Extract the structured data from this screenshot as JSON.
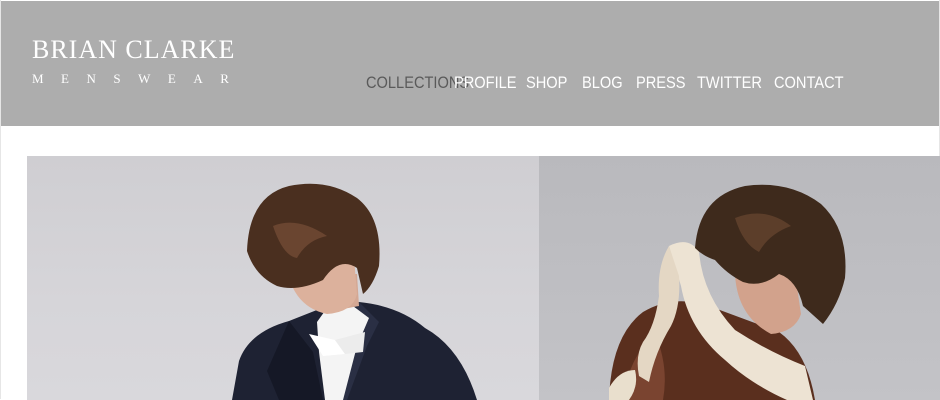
{
  "brand": {
    "title": "BRIAN CLARKE",
    "subtitle": "MENSWEAR"
  },
  "nav": {
    "items": [
      {
        "label": "COLLECTIONS",
        "active": true
      },
      {
        "label": "PROFILE"
      },
      {
        "label": "SHOP"
      },
      {
        "label": "BLOG"
      },
      {
        "label": "PRESS"
      },
      {
        "label": "TWITTER"
      },
      {
        "label": "CONTACT"
      }
    ]
  },
  "colors": {
    "header_bg": "#adadad",
    "nav_text": "#ffffff",
    "nav_active": "#5a5a5a"
  }
}
